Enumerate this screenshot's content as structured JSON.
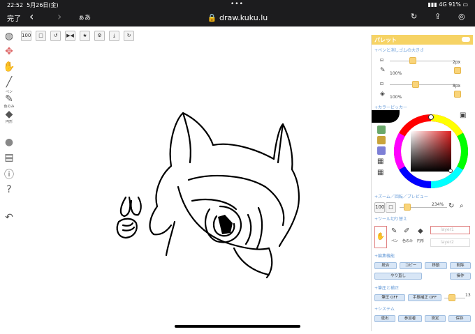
{
  "status": {
    "time": "22:52",
    "date": "5月26日(金)",
    "dots": "•••",
    "network": "4G",
    "battery": "91%"
  },
  "browser": {
    "done_label": "完了",
    "aa_label": "ぁあ",
    "url": "draw.kuku.lu"
  },
  "top_tools": [
    "100",
    "□",
    "↺",
    "▶◀",
    "★",
    "⚙",
    "⤓",
    "↻"
  ],
  "left_tools": {
    "pen_label": "ペン",
    "colorpick_label": "色のみ",
    "circle_label": "円形"
  },
  "palette": {
    "title": "パレット",
    "pen_size_title": "+ペンと消しゴムの大きさ",
    "pen_size": "2px",
    "pen_opacity": "100%",
    "eraser_size": "8px",
    "eraser_opacity": "100%",
    "color_picker_title": "+カラーピッカー",
    "zoom_title": "+ズーム／回転／プレビュー",
    "zoom_value": "234%",
    "tool_switch_title": "+ツール切り替え",
    "tool_labels": [
      "ペン",
      "色のみ",
      "円形"
    ],
    "layer1": "layer1",
    "layer2": "layer2",
    "edit_title": "+編集機能",
    "btn_merge": "統合",
    "btn_copy": "コピー",
    "btn_move": "移動",
    "btn_delete": "削除",
    "btn_undo": "やり直し",
    "btn_operation": "操作",
    "pressure_title": "+筆圧と補正",
    "btn_pressure": "筆圧 OFF",
    "btn_correction": "手振補正 OFF",
    "correction_value": "13",
    "system_title": "+システム",
    "btn_exit": "退出",
    "btn_participants": "参加者",
    "btn_settings": "設定",
    "btn_save": "保存"
  },
  "colors": {
    "swatches": [
      "#6aa86a",
      "#c9a43a",
      "#7d7fd6"
    ],
    "accent": "#f6d365"
  }
}
